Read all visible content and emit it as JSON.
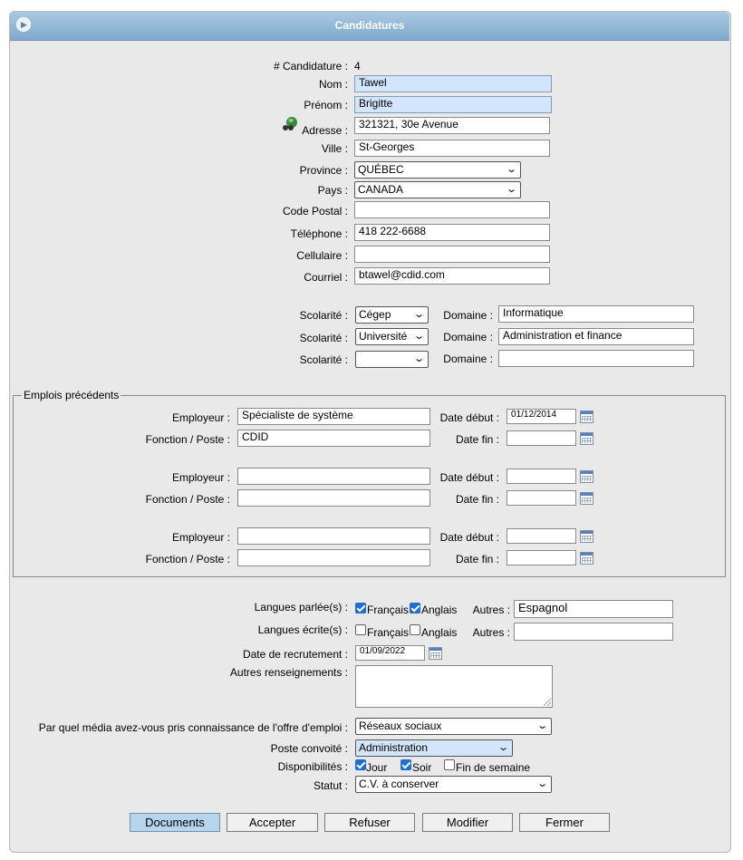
{
  "header": {
    "title": "Candidatures"
  },
  "candidate": {
    "number_label": "# Candidature :",
    "number": "4",
    "nom_label": "Nom :",
    "nom": "Tawel",
    "prenom_label": "Prénom :",
    "prenom": "Brigitte",
    "adresse_label": "Adresse :",
    "adresse": "321321, 30e Avenue",
    "ville_label": "Ville :",
    "ville": "St-Georges",
    "province_label": "Province :",
    "province": "QUÉBEC",
    "pays_label": "Pays :",
    "pays": "CANADA",
    "code_postal_label": "Code Postal :",
    "code_postal": "",
    "telephone_label": "Téléphone :",
    "telephone": "418 222-6688",
    "cellulaire_label": "Cellulaire :",
    "cellulaire": "",
    "courriel_label": "Courriel :",
    "courriel": "btawel@cdid.com"
  },
  "scolarite": {
    "label": "Scolarité :",
    "domaine_label": "Domaine :",
    "rows": [
      {
        "niveau": "Cégep",
        "domaine": "Informatique"
      },
      {
        "niveau": "Université",
        "domaine": "Administration et finance"
      },
      {
        "niveau": "",
        "domaine": ""
      }
    ]
  },
  "emplois": {
    "legend": "Emplois précédents",
    "employeur_label": "Employeur :",
    "fonction_label": "Fonction / Poste :",
    "date_debut_label": "Date début :",
    "date_fin_label": "Date fin :",
    "rows": [
      {
        "employeur": "Spécialiste de système",
        "fonction": "CDID",
        "date_debut": "01/12/2014",
        "date_fin": ""
      },
      {
        "employeur": "",
        "fonction": "",
        "date_debut": "",
        "date_fin": ""
      },
      {
        "employeur": "",
        "fonction": "",
        "date_debut": "",
        "date_fin": ""
      }
    ]
  },
  "langues": {
    "parlees_label": "Langues parlée(s) :",
    "ecrites_label": "Langues écrite(s) :",
    "francais": "Français",
    "anglais": "Anglais",
    "autres_label": "Autres :",
    "parlees_francais": true,
    "parlees_anglais": true,
    "parlees_autres": "Espagnol",
    "ecrites_francais": false,
    "ecrites_anglais": false,
    "ecrites_autres": ""
  },
  "recrutement": {
    "date_label": "Date de recrutement :",
    "date": "01/09/2022",
    "autres_label": "Autres renseignements :",
    "autres": "",
    "media_label": "Par quel média avez-vous pris connaissance de l'offre d'emploi :",
    "media": "Réseaux sociaux",
    "poste_label": "Poste convoité :",
    "poste": "Administration",
    "dispo_label": "Disponibilités :",
    "jour": "Jour",
    "soir": "Soir",
    "fin_semaine": "Fin de semaine",
    "jour_checked": true,
    "soir_checked": true,
    "fin_semaine_checked": false,
    "statut_label": "Statut :",
    "statut": "C.V. à conserver"
  },
  "buttons": {
    "documents": "Documents",
    "accepter": "Accepter",
    "refuser": "Refuser",
    "modifier": "Modifier",
    "fermer": "Fermer"
  },
  "colors": {
    "header": "#7fa9cc",
    "highlight": "#d3e5fb",
    "checkbox": "#1f6fd0"
  },
  "icons": [
    "arrow-right-icon",
    "globe-icon",
    "calendar-icon",
    "chevron-down-icon",
    "checkbox-icon"
  ]
}
